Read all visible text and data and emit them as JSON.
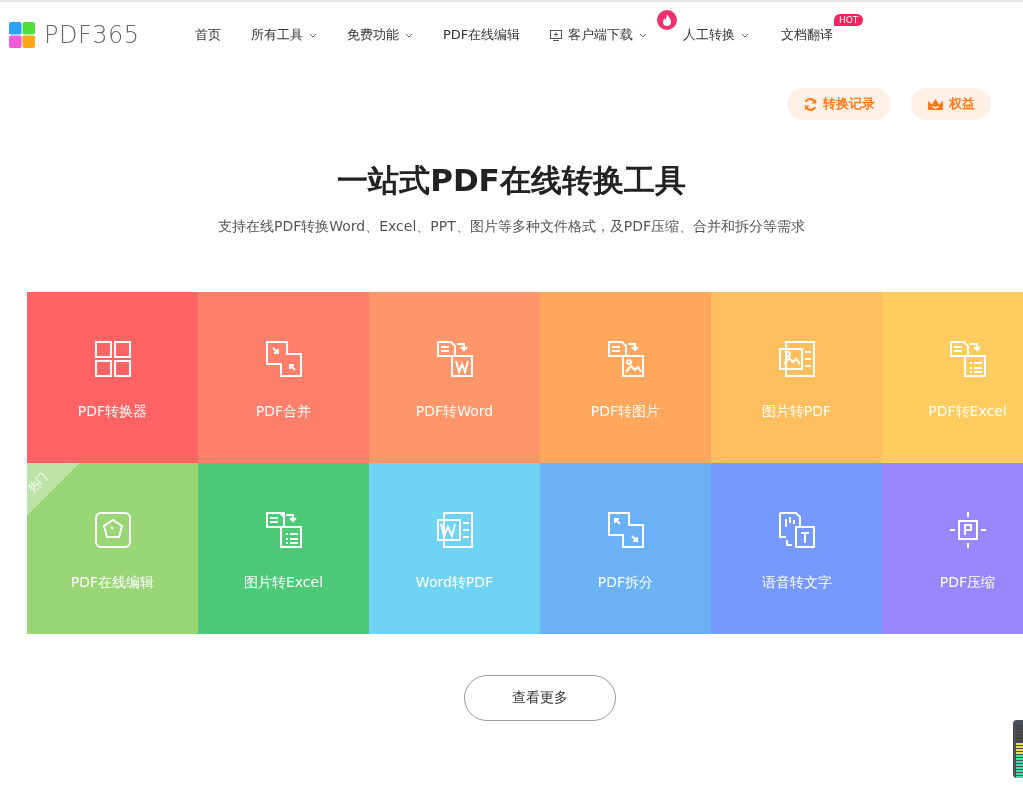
{
  "logo": {
    "text": "PDF365"
  },
  "nav": [
    {
      "label": "首页",
      "caret": false
    },
    {
      "label": "所有工具",
      "caret": true
    },
    {
      "label": "免费功能",
      "caret": true
    },
    {
      "label": "PDF在线编辑",
      "caret": false
    },
    {
      "label": "客户端下载",
      "caret": true
    },
    {
      "label": "人工转换",
      "caret": true
    },
    {
      "label": "文档翻译",
      "caret": false,
      "badge": "HOT"
    }
  ],
  "actions": [
    "转换记录",
    "权益"
  ],
  "hero": {
    "title": "一站式PDF在线转换工具",
    "subtitle": "支持在线PDF转换Word、Excel、PPT、图片等多种文件格式，及PDF压缩、合并和拆分等需求"
  },
  "tools": [
    {
      "label": "PDF转换器",
      "color": "#ff6363"
    },
    {
      "label": "PDF合并",
      "color": "#ff7f6b"
    },
    {
      "label": "PDF转Word",
      "color": "#ff9669"
    },
    {
      "label": "PDF转图片",
      "color": "#ffa75d"
    },
    {
      "label": "图片转PDF",
      "color": "#ffbf5f"
    },
    {
      "label": "PDF转Excel",
      "color": "#ffcc5f"
    },
    {
      "label": "PDF在线编辑",
      "color": "#98d676",
      "badge": "热门"
    },
    {
      "label": "图片转Excel",
      "color": "#4cca78"
    },
    {
      "label": "Word转PDF",
      "color": "#6fd3f3"
    },
    {
      "label": "PDF拆分",
      "color": "#6bb1f6"
    },
    {
      "label": "语音转文字",
      "color": "#7599fc"
    },
    {
      "label": "PDF压缩",
      "color": "#9a86fd"
    }
  ],
  "more_button": "查看更多"
}
